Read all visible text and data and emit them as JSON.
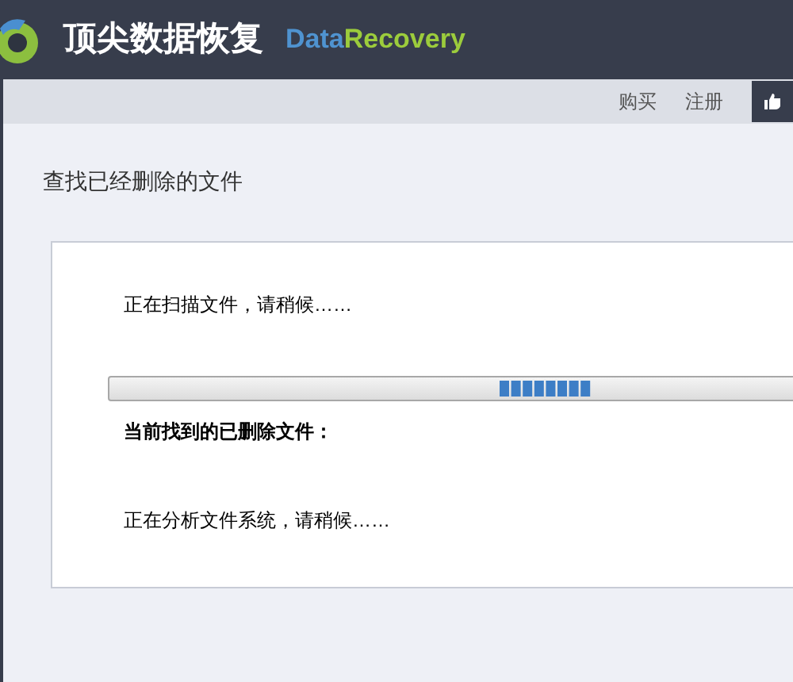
{
  "header": {
    "title": "顶尖数据恢复",
    "brand_part_1": "Data",
    "brand_part_2": "Recovery"
  },
  "toolbar": {
    "links": [
      "购买",
      "注册"
    ]
  },
  "page_title": "查找已经删除的文件",
  "scan": {
    "status": "正在扫描文件，请稍候……",
    "progress": {
      "indeterminate": true
    },
    "found_label": "当前找到的已删除文件：",
    "analysis": "正在分析文件系统，请稍候……"
  }
}
